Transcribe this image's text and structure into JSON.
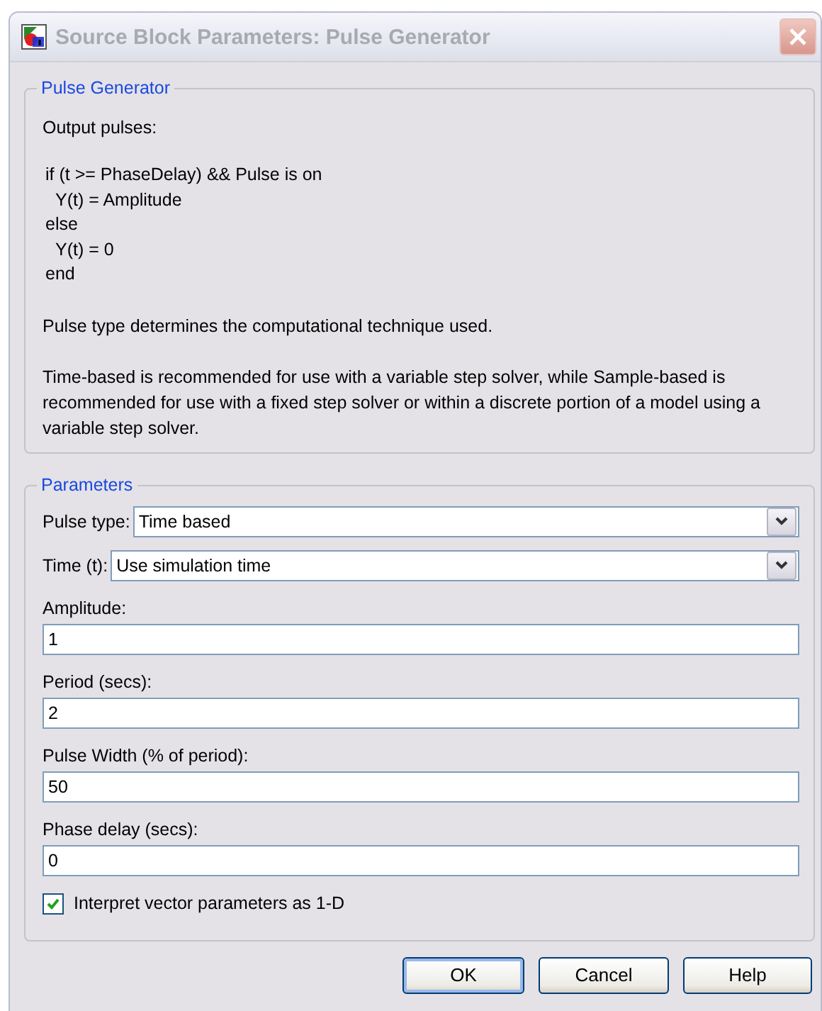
{
  "window": {
    "title": "Source Block Parameters: Pulse Generator",
    "active": false
  },
  "description": {
    "title": "Pulse Generator",
    "intro": "Output pulses:",
    "code": [
      {
        "text": "if (t >= PhaseDelay) && Pulse is on",
        "indent": false
      },
      {
        "text": "Y(t) = Amplitude",
        "indent": true
      },
      {
        "text": "else",
        "indent": false
      },
      {
        "text": "Y(t) = 0",
        "indent": true
      },
      {
        "text": "end",
        "indent": false
      }
    ],
    "paragraphs": [
      "Pulse type determines the computational technique used.",
      "Time-based is recommended for use with a variable step solver, while Sample-based is recommended for use with a fixed step solver or within a discrete portion of a model using a variable step solver."
    ]
  },
  "parameters": {
    "title": "Parameters",
    "items": [
      {
        "kind": "dropdown",
        "label": "Pulse type:",
        "value": "Time based"
      },
      {
        "kind": "dropdown",
        "label": "Time (t):",
        "value": "Use simulation time"
      },
      {
        "kind": "edit",
        "label": "Amplitude:",
        "value": "1"
      },
      {
        "kind": "edit",
        "label": "Period (secs):",
        "value": "2"
      },
      {
        "kind": "edit",
        "label": "Pulse Width (% of period):",
        "value": "50"
      },
      {
        "kind": "edit",
        "label": "Phase delay (secs):",
        "value": "0"
      },
      {
        "kind": "checkbox",
        "label": "Interpret vector parameters as 1-D",
        "checked": true
      }
    ]
  },
  "buttons": [
    {
      "label": "OK",
      "default": true
    },
    {
      "label": "Cancel",
      "default": false
    },
    {
      "label": "Help",
      "default": false
    }
  ]
}
